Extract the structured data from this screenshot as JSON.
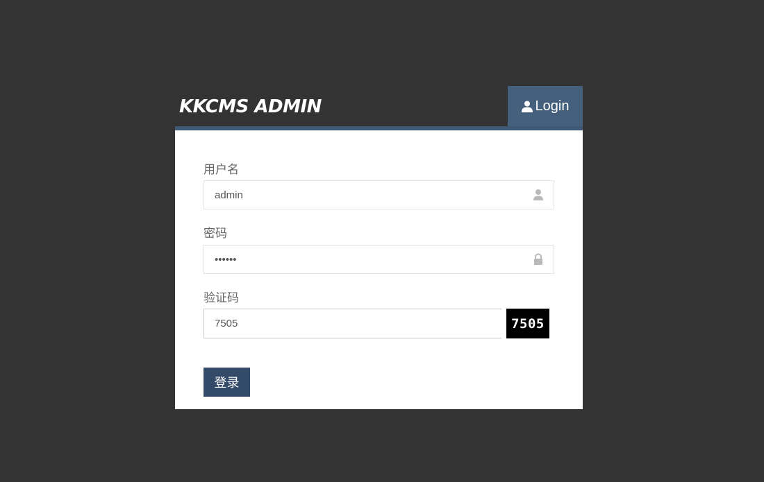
{
  "header": {
    "brand": "KKCMS ADMIN",
    "tab_label": "Login",
    "tab_icon": "user-icon"
  },
  "form": {
    "username_label": "用户名",
    "username_value": "admin",
    "username_icon": "user-icon",
    "password_label": "密码",
    "password_value": "••••••",
    "password_icon": "lock-icon",
    "captcha_label": "验证码",
    "captcha_value": "7505",
    "captcha_image_text": "7505",
    "submit_label": "登录"
  },
  "colors": {
    "background": "#333333",
    "header_tab": "#45607c",
    "header_border": "#3f5874",
    "button": "#334b69"
  }
}
